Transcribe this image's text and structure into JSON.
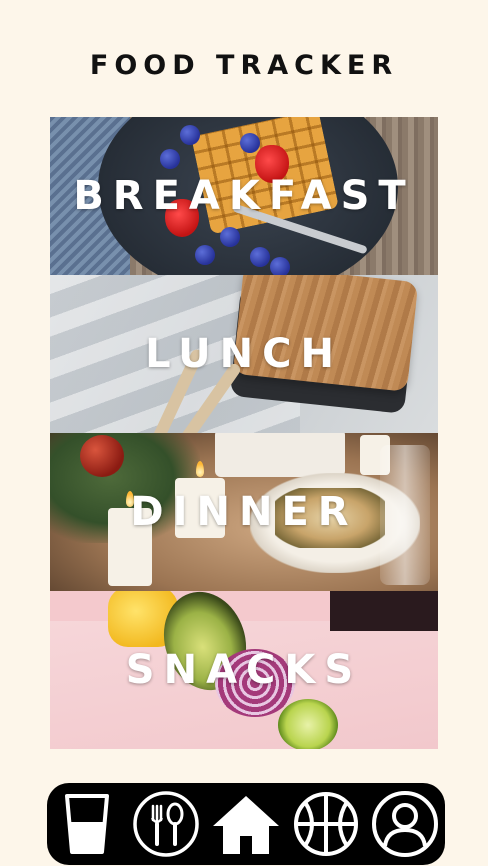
{
  "header": {
    "title": "FOOD TRACKER"
  },
  "meals": [
    {
      "label": "BREAKFAST"
    },
    {
      "label": "LUNCH"
    },
    {
      "label": "DINNER"
    },
    {
      "label": "SNACKS"
    }
  ],
  "nav": {
    "items": [
      {
        "icon": "water-glass-icon"
      },
      {
        "icon": "fork-spoon-icon"
      },
      {
        "icon": "home-icon",
        "active": true
      },
      {
        "icon": "basketball-icon"
      },
      {
        "icon": "profile-icon"
      }
    ]
  },
  "colors": {
    "background": "#fdf6ea",
    "nav": "#000000",
    "icon": "#ffffff"
  }
}
